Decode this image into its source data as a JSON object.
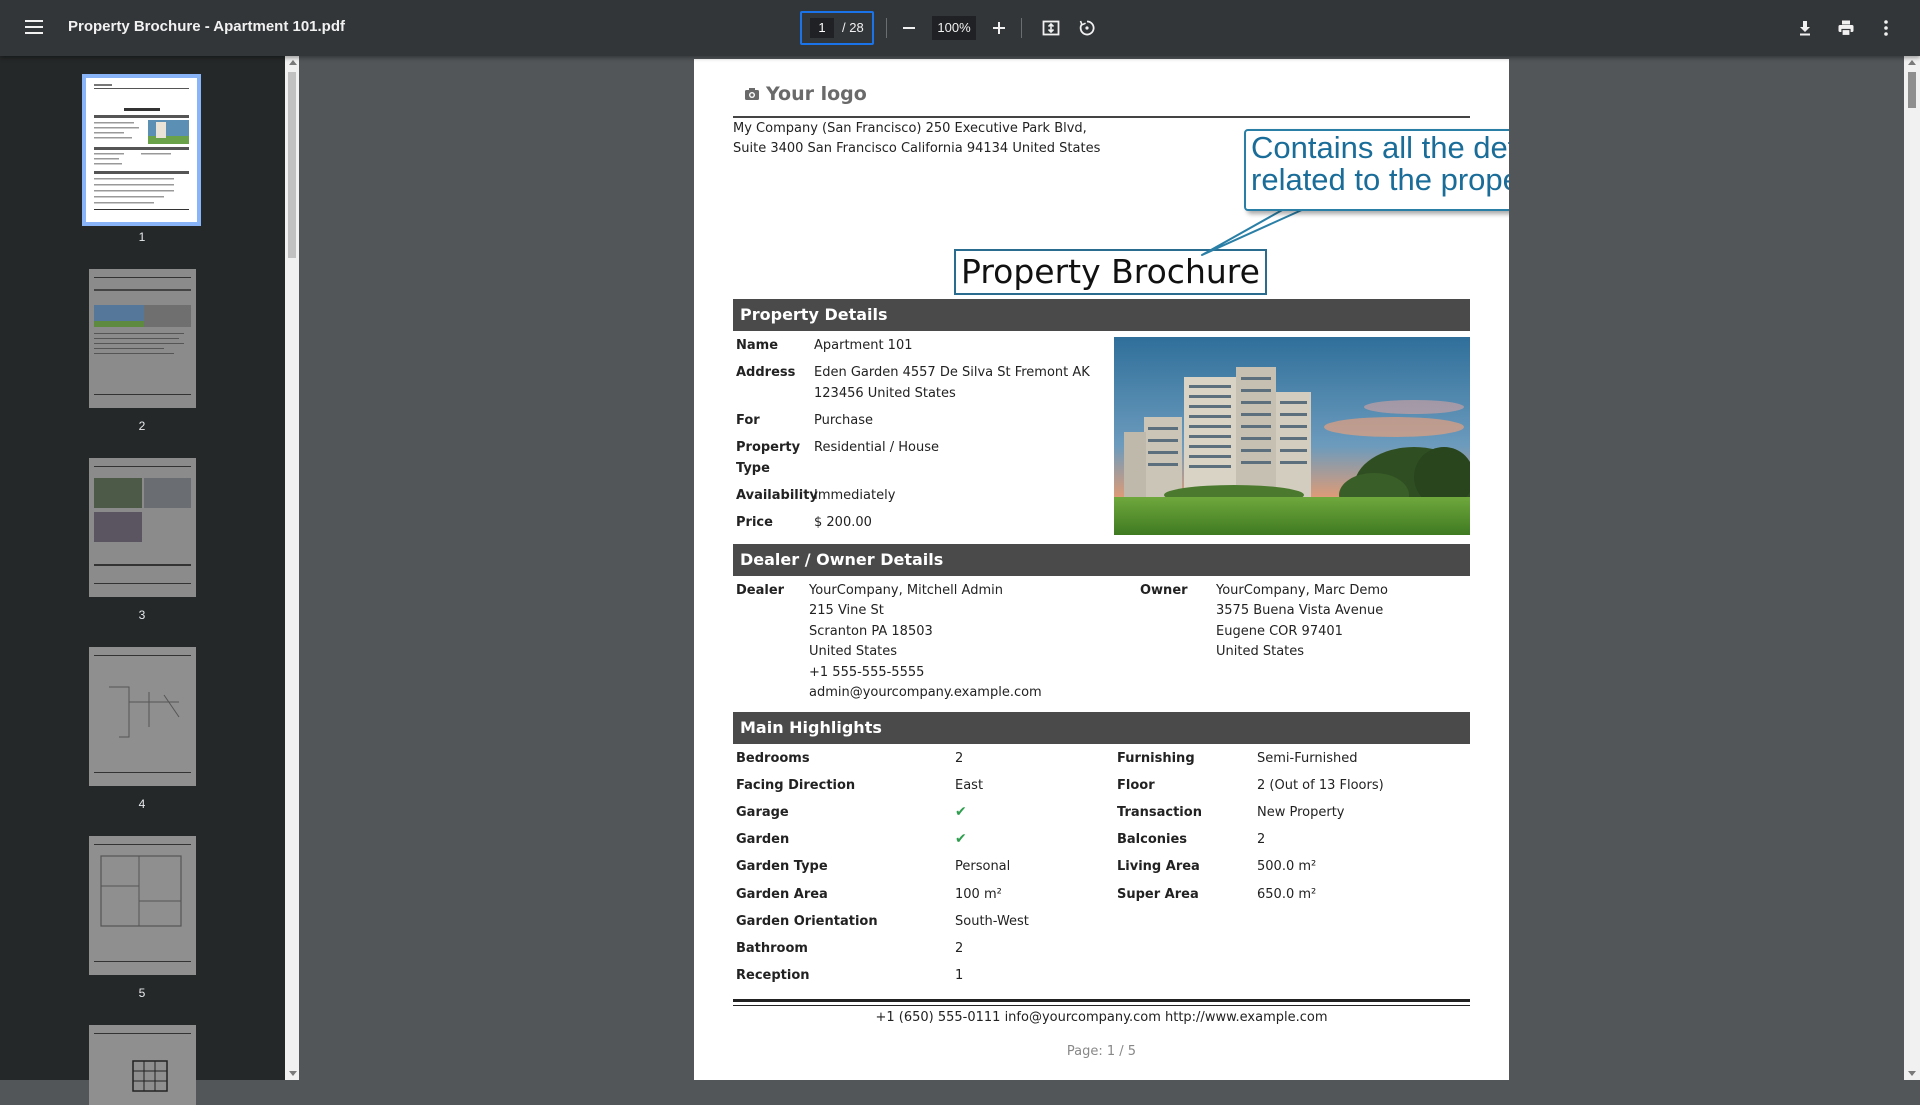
{
  "toolbar": {
    "title": "Property Brochure - Apartment 101.pdf",
    "page_current": "1",
    "page_total": "/ 28",
    "zoom": "100%",
    "icons": [
      "menu-icon",
      "zoom-out-icon",
      "zoom-in-icon",
      "fit-page-icon",
      "rotate-icon",
      "download-icon",
      "print-icon",
      "more-vert-icon"
    ]
  },
  "thumbnails": [
    {
      "label": "1"
    },
    {
      "label": "2"
    },
    {
      "label": "3"
    },
    {
      "label": "4"
    },
    {
      "label": "5"
    }
  ],
  "document": {
    "logo_text": "Your logo",
    "company_address_1": "My Company (San Francisco) 250 Executive Park Blvd,",
    "company_address_2": "Suite 3400 San Francisco California 94134 United States",
    "callout_1": "Contains all the details",
    "callout_2": "related to the property",
    "title": "Property Brochure",
    "property_details": {
      "heading": "Property Details",
      "rows": [
        {
          "label": "Name",
          "value": "Apartment 101"
        },
        {
          "label": "Address",
          "value": "Eden Garden 4557 De Silva St Fremont AK",
          "value2": "123456 United States"
        },
        {
          "label": "For",
          "value": "Purchase"
        },
        {
          "label": "Property",
          "label2": "Type",
          "value": "Residential / House"
        },
        {
          "label": "Availability",
          "value": "Immediately"
        },
        {
          "label": "Price",
          "value": "$ 200.00"
        }
      ]
    },
    "dealer_owner": {
      "heading": "Dealer / Owner Details",
      "dealer_label": "Dealer",
      "dealer_lines": [
        "YourCompany, Mitchell Admin",
        "215 Vine St",
        "Scranton PA 18503",
        "United States",
        "+1 555-555-5555",
        "admin@yourcompany.example.com"
      ],
      "owner_label": "Owner",
      "owner_lines": [
        "YourCompany, Marc Demo",
        "3575 Buena Vista Avenue",
        "Eugene COR 97401",
        "United States"
      ]
    },
    "highlights": {
      "heading": "Main Highlights",
      "left": [
        {
          "label": "Bedrooms",
          "value": "2"
        },
        {
          "label": "Facing Direction",
          "value": "East"
        },
        {
          "label": "Garage",
          "value": "✔"
        },
        {
          "label": "Garden",
          "value": "✔"
        },
        {
          "label": "Garden Type",
          "value": "Personal"
        },
        {
          "label": "Garden Area",
          "value": "100 m²"
        },
        {
          "label": "Garden Orientation",
          "value": "South-West"
        },
        {
          "label": "Bathroom",
          "value": "2"
        },
        {
          "label": "Reception",
          "value": "1"
        }
      ],
      "right": [
        {
          "label": "Furnishing",
          "value": "Semi-Furnished"
        },
        {
          "label": "Floor",
          "value": "2 (Out of 13 Floors)"
        },
        {
          "label": "Transaction",
          "value": "New Property"
        },
        {
          "label": "Balconies",
          "value": "2"
        },
        {
          "label": "Living Area",
          "value": "500.0 m²"
        },
        {
          "label": "Super Area",
          "value": "650.0 m²"
        }
      ]
    },
    "footer": "+1 (650) 555-0111 info@yourcompany.com http://www.example.com",
    "page_label": "Page: 1 / 5"
  }
}
